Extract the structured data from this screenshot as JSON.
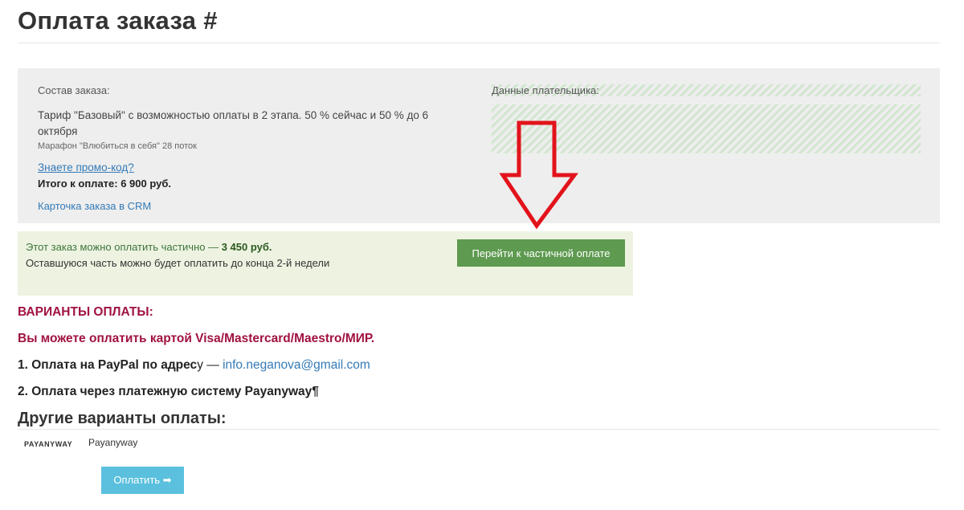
{
  "page": {
    "title": "Оплата заказа #"
  },
  "order": {
    "section_label": "Состав заказа:",
    "tariff": "Тариф \"Базовый\" с возможностью оплаты в 2 этапа. 50 % сейчас и 50 % до 6 октября",
    "marathon": "Марафон \"Влюбиться в себя\" 28 поток",
    "promo_link": "Знаете промо-код?",
    "total": "Итого к оплате: 6 900 руб.",
    "crm_link": "Карточка заказа в CRM"
  },
  "payer": {
    "label": "Данные плательщика:"
  },
  "partial": {
    "text": "Этот заказ можно оплатить частично — ",
    "amount": "3 450 руб.",
    "text_tail": "",
    "remainder": "Оставшуюся часть можно будет оплатить до конца 2-й недели",
    "button_label": "Перейти к частичной оплате"
  },
  "variants": {
    "heading": "ВАРИАНТЫ ОПЛАТЫ:",
    "card_line": "Вы можете оплатить картой Visa/Mastercard/Maestro/МИР.",
    "paypal_prefix": "1. Оплата на PayPal по адрес",
    "paypal_suffix": "у — ",
    "paypal_email": "info.neganova@gmail.com",
    "payanyway_line": "2. Оплата через платежную систему Payanyway¶"
  },
  "other": {
    "heading": "Другие варианты оплаты:",
    "provider_logo": "PAYANYWAY",
    "provider_name": "Payanyway",
    "pay_button": "Оплатить",
    "pay_button_icon": "➡"
  },
  "colors": {
    "accent_red": "#a0123f",
    "button_green": "#5e9a50",
    "button_blue": "#5bc0de",
    "link_blue": "#337ab7",
    "annotation_arrow": "#e3131b"
  }
}
